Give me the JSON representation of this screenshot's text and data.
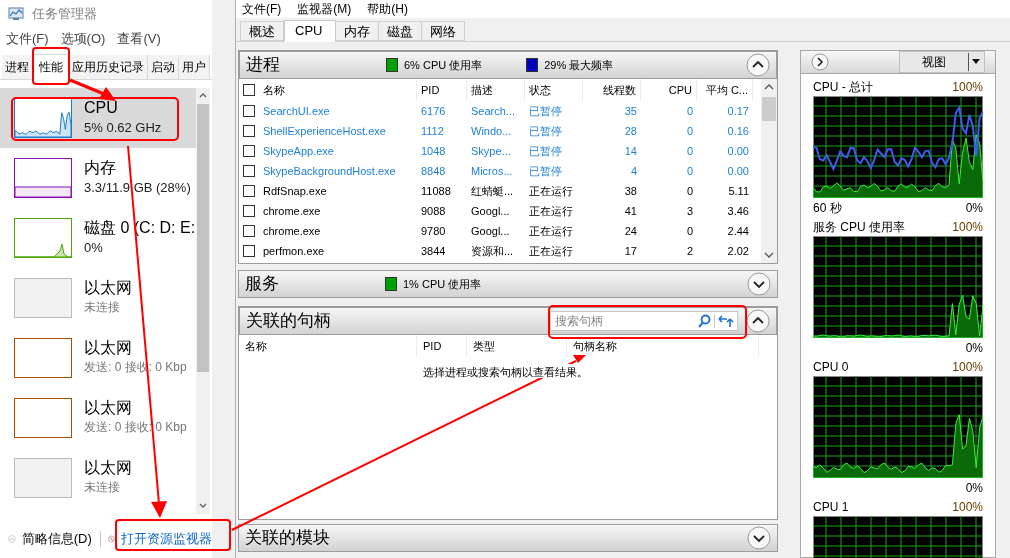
{
  "task_manager": {
    "title": "任务管理器",
    "menu": [
      "文件(F)",
      "选项(O)",
      "查看(V)"
    ],
    "tabs": [
      {
        "label": "进程",
        "selected": false
      },
      {
        "label": "性能",
        "selected": true
      },
      {
        "label": "应用历史记录",
        "selected": false
      },
      {
        "label": "启动",
        "selected": false
      },
      {
        "label": "用户",
        "selected": false
      }
    ],
    "resources": [
      {
        "kind": "cpu",
        "name": "CPU",
        "detail": "5% 0.62 GHz",
        "selected": true,
        "color": "#1c7ec4"
      },
      {
        "kind": "memory",
        "name": "内存",
        "detail": "3.3/11.9 GB (28%)",
        "selected": false,
        "color": "#8b12ae"
      },
      {
        "kind": "disk",
        "name": "磁盘 0 (C: D: E:",
        "detail": "0%",
        "selected": false,
        "color": "#4da60c"
      },
      {
        "kind": "ethernet",
        "name": "以太网",
        "detail": "未连接",
        "selected": false,
        "color": "#bcbcbc"
      },
      {
        "kind": "ethernet",
        "name": "以太网",
        "detail": "发送: 0 接收: 0 Kbp",
        "selected": false,
        "color": "#a74f01"
      },
      {
        "kind": "ethernet",
        "name": "以太网",
        "detail": "发送: 0 接收: 0 Kbp",
        "selected": false,
        "color": "#a74f01"
      },
      {
        "kind": "ethernet",
        "name": "以太网",
        "detail": "未连接",
        "selected": false,
        "color": "#bcbcbc"
      }
    ],
    "footer": {
      "details_toggle": "简略信息(D)",
      "open_monitor_link": "打开资源监视器"
    }
  },
  "resource_monitor": {
    "menu": [
      "文件(F)",
      "监视器(M)",
      "帮助(H)"
    ],
    "tabs": [
      {
        "label": "概述",
        "selected": false
      },
      {
        "label": "CPU",
        "selected": true
      },
      {
        "label": "内存",
        "selected": false
      },
      {
        "label": "磁盘",
        "selected": false
      },
      {
        "label": "网络",
        "selected": false
      }
    ],
    "processes": {
      "title": "进程",
      "expanded": true,
      "stats": [
        {
          "text": "6% CPU 使用率",
          "color": "#00a000"
        },
        {
          "text": "29% 最大频率",
          "color": "#0000c0"
        }
      ],
      "select_all_checked": false,
      "columns": [
        "名称",
        "PID",
        "描述",
        "状态",
        "线程数",
        "CPU",
        "平均 C..."
      ],
      "rows": [
        {
          "name": "SearchUI.exe",
          "pid": "6176",
          "description": "Search...",
          "status": "已暂停",
          "threads": "35",
          "cpu": "0",
          "avg_cpu": "0.17",
          "suspended": true,
          "checked": false
        },
        {
          "name": "ShellExperienceHost.exe",
          "pid": "1112",
          "description": "Windo...",
          "status": "已暂停",
          "threads": "28",
          "cpu": "0",
          "avg_cpu": "0.16",
          "suspended": true,
          "checked": false
        },
        {
          "name": "SkypeApp.exe",
          "pid": "1048",
          "description": "Skype...",
          "status": "已暂停",
          "threads": "14",
          "cpu": "0",
          "avg_cpu": "0.00",
          "suspended": true,
          "checked": false
        },
        {
          "name": "SkypeBackgroundHost.exe",
          "pid": "8848",
          "description": "Micros...",
          "status": "已暂停",
          "threads": "4",
          "cpu": "0",
          "avg_cpu": "0.00",
          "suspended": true,
          "checked": false
        },
        {
          "name": "RdfSnap.exe",
          "pid": "11088",
          "description": "红蜻蜓...",
          "status": "正在运行",
          "threads": "38",
          "cpu": "0",
          "avg_cpu": "5.11",
          "suspended": false,
          "checked": false
        },
        {
          "name": "chrome.exe",
          "pid": "9088",
          "description": "Googl...",
          "status": "正在运行",
          "threads": "41",
          "cpu": "3",
          "avg_cpu": "3.46",
          "suspended": false,
          "checked": false
        },
        {
          "name": "chrome.exe",
          "pid": "9780",
          "description": "Googl...",
          "status": "正在运行",
          "threads": "24",
          "cpu": "0",
          "avg_cpu": "2.44",
          "suspended": false,
          "checked": false
        },
        {
          "name": "perfmon.exe",
          "pid": "3844",
          "description": "资源和...",
          "status": "正在运行",
          "threads": "17",
          "cpu": "2",
          "avg_cpu": "2.02",
          "suspended": false,
          "checked": false
        }
      ]
    },
    "services": {
      "title": "服务",
      "expanded": false,
      "stats": [
        {
          "text": "1% CPU 使用率",
          "color": "#00a000"
        }
      ]
    },
    "handles": {
      "title": "关联的句柄",
      "expanded": true,
      "search": {
        "placeholder": "搜索句柄"
      },
      "columns": [
        "名称",
        "PID",
        "类型",
        "句柄名称"
      ],
      "empty_message": "选择进程或搜索句柄以查看结果。"
    },
    "modules": {
      "title": "关联的模块",
      "expanded": false
    },
    "graph_panel": {
      "view_button": "视图",
      "graphs": [
        {
          "title": "CPU - 总计",
          "max": "100%",
          "time": "60 秒",
          "min": "0%",
          "frequency_line": true
        },
        {
          "title": "服务 CPU 使用率",
          "max": "100%",
          "min": "0%",
          "frequency_line": false
        },
        {
          "title": "CPU 0",
          "max": "100%",
          "min": "0%",
          "frequency_line": false
        },
        {
          "title": "CPU 1",
          "max": "100%",
          "frequency_line": false
        }
      ]
    }
  }
}
